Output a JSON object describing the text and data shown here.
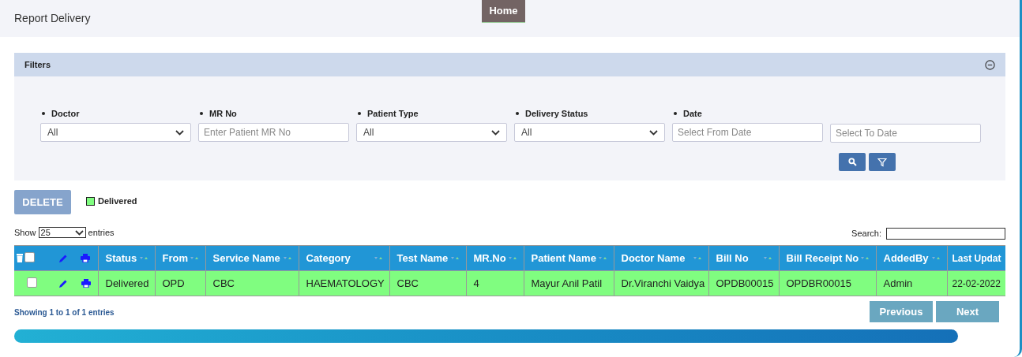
{
  "page": {
    "title": "Report Delivery",
    "home_button": "Home"
  },
  "filters": {
    "title": "Filters",
    "expanded": true,
    "fields": [
      {
        "kind": "select",
        "label": "Doctor",
        "value": "All"
      },
      {
        "kind": "text",
        "label": "MR No",
        "placeholder": "Enter Patient MR No"
      },
      {
        "kind": "select",
        "label": "Patient Type",
        "value": "All"
      },
      {
        "kind": "select",
        "label": "Delivery Status",
        "value": "All"
      },
      {
        "kind": "text",
        "label": "Date",
        "placeholder": "Select From Date"
      },
      {
        "kind": "text",
        "placeholder": "Select To Date"
      }
    ]
  },
  "delete_button": {
    "label": "DELETE",
    "disabled": true
  },
  "legend": [
    {
      "label": "Delivered",
      "color": "#80fd80"
    }
  ],
  "length_menu": {
    "before": "Show",
    "value": "25",
    "after": "entries"
  },
  "search": {
    "label": "Search:"
  },
  "table": {
    "select_all_checked": false,
    "columns": [
      "Status",
      "From",
      "Service Name",
      "Category",
      "Test Name",
      "MR.No",
      "Patient Name",
      "Doctor Name",
      "Bill No",
      "Bill Receipt No",
      "AddedBy",
      "Last Updat"
    ],
    "rows": [
      {
        "checked": false,
        "color": "#80fd80",
        "cells": [
          "Delivered",
          "OPD",
          "CBC",
          "HAEMATOLOGY",
          "CBC",
          "4",
          "Mayur Anil Patil",
          "Dr.Viranchi Vaidya",
          "OPDB00015",
          "OPDBR00015",
          "Admin",
          "22-02-2022"
        ]
      }
    ]
  },
  "info": "Showing 1 to 1 of 1 entries",
  "pagination": [
    {
      "label": "Previous",
      "disabled": true
    },
    {
      "label": "Next",
      "disabled": true
    }
  ]
}
